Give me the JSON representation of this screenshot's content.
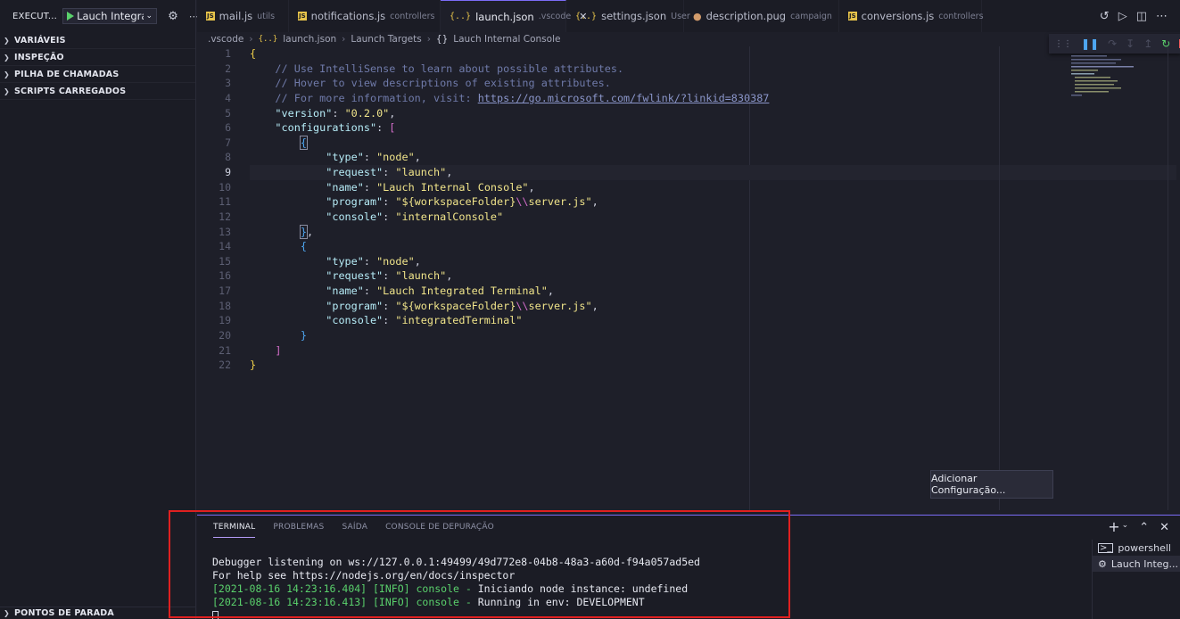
{
  "sidebar": {
    "title": "EXECUT...",
    "run_config": "Lauch Integrat",
    "sections": [
      "VARIÁVEIS",
      "INSPEÇÃO",
      "PILHA DE CHAMADAS",
      "SCRIPTS CARREGADOS"
    ],
    "breakpoints": "PONTOS DE PARADA"
  },
  "tabs": [
    {
      "name": "mail.js",
      "desc": "utils",
      "icon": "js-icon"
    },
    {
      "name": "notifications.js",
      "desc": "controllers",
      "icon": "js-icon"
    },
    {
      "name": "launch.json",
      "desc": ".vscode",
      "icon": "json-icon",
      "active": true
    },
    {
      "name": "settings.json",
      "desc": "User",
      "icon": "json-icon"
    },
    {
      "name": "description.pug",
      "desc": "campaign",
      "icon": "pug-icon"
    },
    {
      "name": "conversions.js",
      "desc": "controllers",
      "icon": "js-icon"
    }
  ],
  "breadcrumb": [
    ".vscode",
    "launch.json",
    "Launch Targets",
    "Lauch Internal Console"
  ],
  "editor": {
    "current_line": 9,
    "lines": [
      "1",
      "2",
      "3",
      "4",
      "5",
      "6",
      "7",
      "8",
      "9",
      "10",
      "11",
      "12",
      "13",
      "14",
      "15",
      "16",
      "17",
      "18",
      "19",
      "20",
      "21",
      "22"
    ],
    "comment1": "// Use IntelliSense to learn about possible attributes.",
    "comment2": "// Hover to view descriptions of existing attributes.",
    "comment3": "// For more information, visit: ",
    "link": "https://go.microsoft.com/fwlink/?linkid=830387",
    "version_key": "\"version\"",
    "version_val": "\"0.2.0\"",
    "configs_key": "\"configurations\"",
    "type_key": "\"type\"",
    "type_val": "\"node\"",
    "request_key": "\"request\"",
    "request_val": "\"launch\"",
    "name_key": "\"name\"",
    "name1_val": "\"Lauch Internal Console\"",
    "name2_val": "\"Lauch Integrated Terminal\"",
    "program_key": "\"program\"",
    "program_pre": "\"${workspaceFolder}",
    "program_esc": "\\\\",
    "program_post": "server.js\"",
    "console_key": "\"console\"",
    "console1_val": "\"internalConsole\"",
    "console2_val": "\"integratedTerminal\""
  },
  "add_config_button": "Adicionar Configuração...",
  "panel": {
    "tabs": [
      "TERMINAL",
      "PROBLEMAS",
      "SAÍDA",
      "CONSOLE DE DEPURAÇÃO"
    ],
    "terminal_lines": [
      "Debugger listening on ws://127.0.0.1:49499/49d772e8-04b8-48a3-a60d-f94a057ad5ed",
      "For help see https://nodejs.org/en/docs/inspector"
    ],
    "log1_prefix": "[2021-08-16 14:23:16.404] [INFO] console - ",
    "log1_msg": "Iniciando node instance: undefined",
    "log2_prefix": "[2021-08-16 14:23:16.413] [INFO] console - ",
    "log2_msg": "Running in env: DEVELOPMENT",
    "terminals": [
      "powershell",
      "Lauch Integ..."
    ]
  },
  "colors": {
    "accent": "#7b6cf6",
    "highlight": "#e02020",
    "string": "#f0e48a",
    "key": "#b6ecf7"
  }
}
